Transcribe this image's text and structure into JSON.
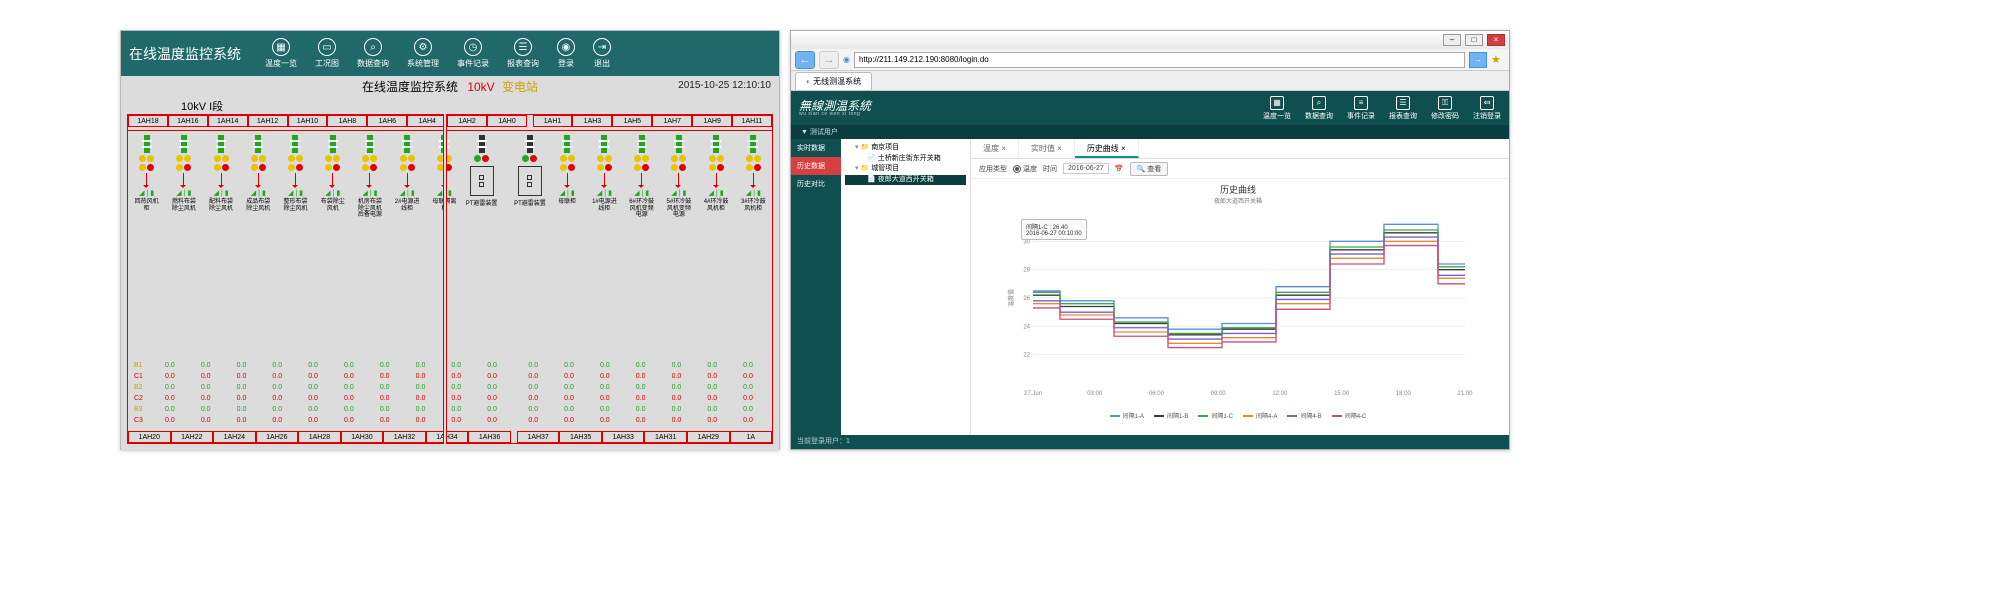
{
  "left_window": {
    "app_title": "在线温度监控系统",
    "nav": [
      "温度一览",
      "工况图",
      "数据查询",
      "系统管理",
      "事件记录",
      "报表查询",
      "登录",
      "退出"
    ],
    "nav_icons": [
      "grid-icon",
      "monitor-icon",
      "magnify-icon",
      "gear-icon",
      "clock-icon",
      "document-icon",
      "user-icon",
      "exit-icon"
    ],
    "system_title": "在线温度监控系统",
    "voltage": "10kV",
    "station": "变电站",
    "timestamp": "2015-10-25 12:10:10",
    "section_label": "10kV I段",
    "bays_top_left": [
      "1AH18",
      "1AH16",
      "1AH14",
      "1AH12",
      "1AH10",
      "1AH8",
      "1AH6",
      "1AH4",
      "1AH2",
      "1AH0"
    ],
    "bays_top_right": [
      "1AH1",
      "1AH3",
      "1AH5",
      "1AH7",
      "1AH9",
      "1AH11"
    ],
    "bays_bot_left": [
      "1AH20",
      "1AH22",
      "1AH24",
      "1AH26",
      "1AH28",
      "1AH30",
      "1AH32",
      "1AH34",
      "1AH36"
    ],
    "bays_bot_right": [
      "1AH37",
      "1AH35",
      "1AH33",
      "1AH31",
      "1AH29",
      "1A"
    ],
    "col_labels_left": [
      "回热风机柜",
      "燃料布袋除尘风机",
      "配料布袋除尘风机",
      "成品布袋除尘风机",
      "整形布袋除尘风机",
      "布袋除尘风机",
      "机房布袋除尘风机后备电源",
      "2#电源进线柜",
      "母联隔离柜",
      ""
    ],
    "col_labels_right": [
      "",
      "母联柜",
      "1#电源进线柜",
      "6#环冷鼓风机变频电源",
      "5#环冷鼓风机变频电源",
      "4#环冷鼓风机柜",
      "3#环冷鼓风机柜"
    ],
    "pt_label": "PT避雷装置",
    "meas_labels": [
      "B1",
      "C1",
      "B2",
      "C2",
      "B3",
      "C3"
    ],
    "meas_value": "0.0"
  },
  "right_window": {
    "browser": {
      "url": "http://211.149.212.190:8080/login.do",
      "tab_title": "无线测温系统",
      "favicon": "thermometer-icon"
    },
    "app": {
      "logo": "無線測温系統",
      "logo_pinyin": "wu xian ce wen xi tong",
      "user_bar": "▼ 测试用户",
      "nav": [
        "温度一览",
        "数据查询",
        "事件记录",
        "报表查询",
        "修改密码",
        "注销登录"
      ],
      "nav_icons": [
        "grid-icon",
        "magnify-icon",
        "list-icon",
        "document-icon",
        "key-icon",
        "logout-icon"
      ],
      "side": [
        "实时数据",
        "历史数据",
        "历史对比"
      ],
      "side_active": 1,
      "tree": {
        "root1": "南京项目",
        "root1_child": "土桥新庄街东开关箱",
        "root2": "城管项目",
        "root2_child": "夜郎大道西开关箱"
      },
      "tabs": [
        "温度 ×",
        "实时值 ×",
        "历史曲线 ×"
      ],
      "tabs_active": 2,
      "filter": {
        "type_label": "应用类型",
        "type_value": "温度",
        "time_label": "时间",
        "date": "2016-06-27",
        "btn": "查看"
      },
      "chart": {
        "title": "历史曲线",
        "subtitle": "夜郎大道西开关箱",
        "tooltip_name": "间隔1-C : 26.40",
        "tooltip_time": "2016-06-27 00:10:00",
        "ylabel": "温度值"
      },
      "statusbar": "当前登录用户：1"
    }
  },
  "chart_data": {
    "type": "line",
    "xlabel": "",
    "ylabel": "温度值",
    "title": "历史曲线",
    "x": [
      "27.Jun",
      "03:00",
      "06:00",
      "09:00",
      "12:00",
      "15:00",
      "18:00",
      "21:00"
    ],
    "ylim": [
      20,
      32
    ],
    "yticks": [
      22,
      24,
      26,
      28,
      30
    ],
    "series": [
      {
        "name": "间隔1-A",
        "color": "#5a8fd8",
        "values": [
          26.5,
          25.8,
          24.6,
          23.8,
          24.2,
          26.8,
          30.0,
          31.2,
          28.4
        ]
      },
      {
        "name": "间隔1-B",
        "color": "#3a3a3a",
        "values": [
          26.2,
          25.4,
          24.2,
          23.4,
          23.8,
          26.2,
          29.4,
          30.6,
          28.0
        ]
      },
      {
        "name": "间隔1-C",
        "color": "#3aa84f",
        "values": [
          26.4,
          25.6,
          24.3,
          23.5,
          23.9,
          26.4,
          29.6,
          30.8,
          28.2
        ]
      },
      {
        "name": "间隔4-A",
        "color": "#e68a2e",
        "values": [
          25.6,
          24.8,
          23.6,
          22.8,
          23.2,
          25.6,
          28.8,
          30.0,
          27.4
        ]
      },
      {
        "name": "间隔4-B",
        "color": "#7a5fc9",
        "values": [
          25.8,
          25.0,
          23.9,
          23.1,
          23.5,
          25.9,
          29.1,
          30.3,
          27.6
        ]
      },
      {
        "name": "间隔4-C",
        "color": "#d6497a",
        "values": [
          25.3,
          24.5,
          23.3,
          22.5,
          22.9,
          25.2,
          28.4,
          29.7,
          27.0
        ]
      }
    ]
  }
}
